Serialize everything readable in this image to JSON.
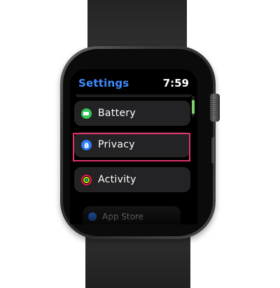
{
  "header": {
    "title": "Settings",
    "time": "7:59"
  },
  "list": {
    "items": [
      {
        "label": "Battery",
        "icon": "battery-icon",
        "icon_color": "#34c759"
      },
      {
        "label": "Privacy",
        "icon": "privacy-hand-icon",
        "icon_color": "#2f7cf6",
        "highlighted": true
      },
      {
        "label": "Activity",
        "icon": "activity-rings-icon",
        "icon_color": "#fa114f"
      },
      {
        "label": "App Store",
        "icon": "app-store-icon",
        "icon_color": "#2f7cf6"
      }
    ]
  },
  "colors": {
    "accent": "#3f8cff",
    "highlight_border": "#e0336d",
    "row_background": "#232325",
    "scroll_thumb": "#7ad16a"
  }
}
